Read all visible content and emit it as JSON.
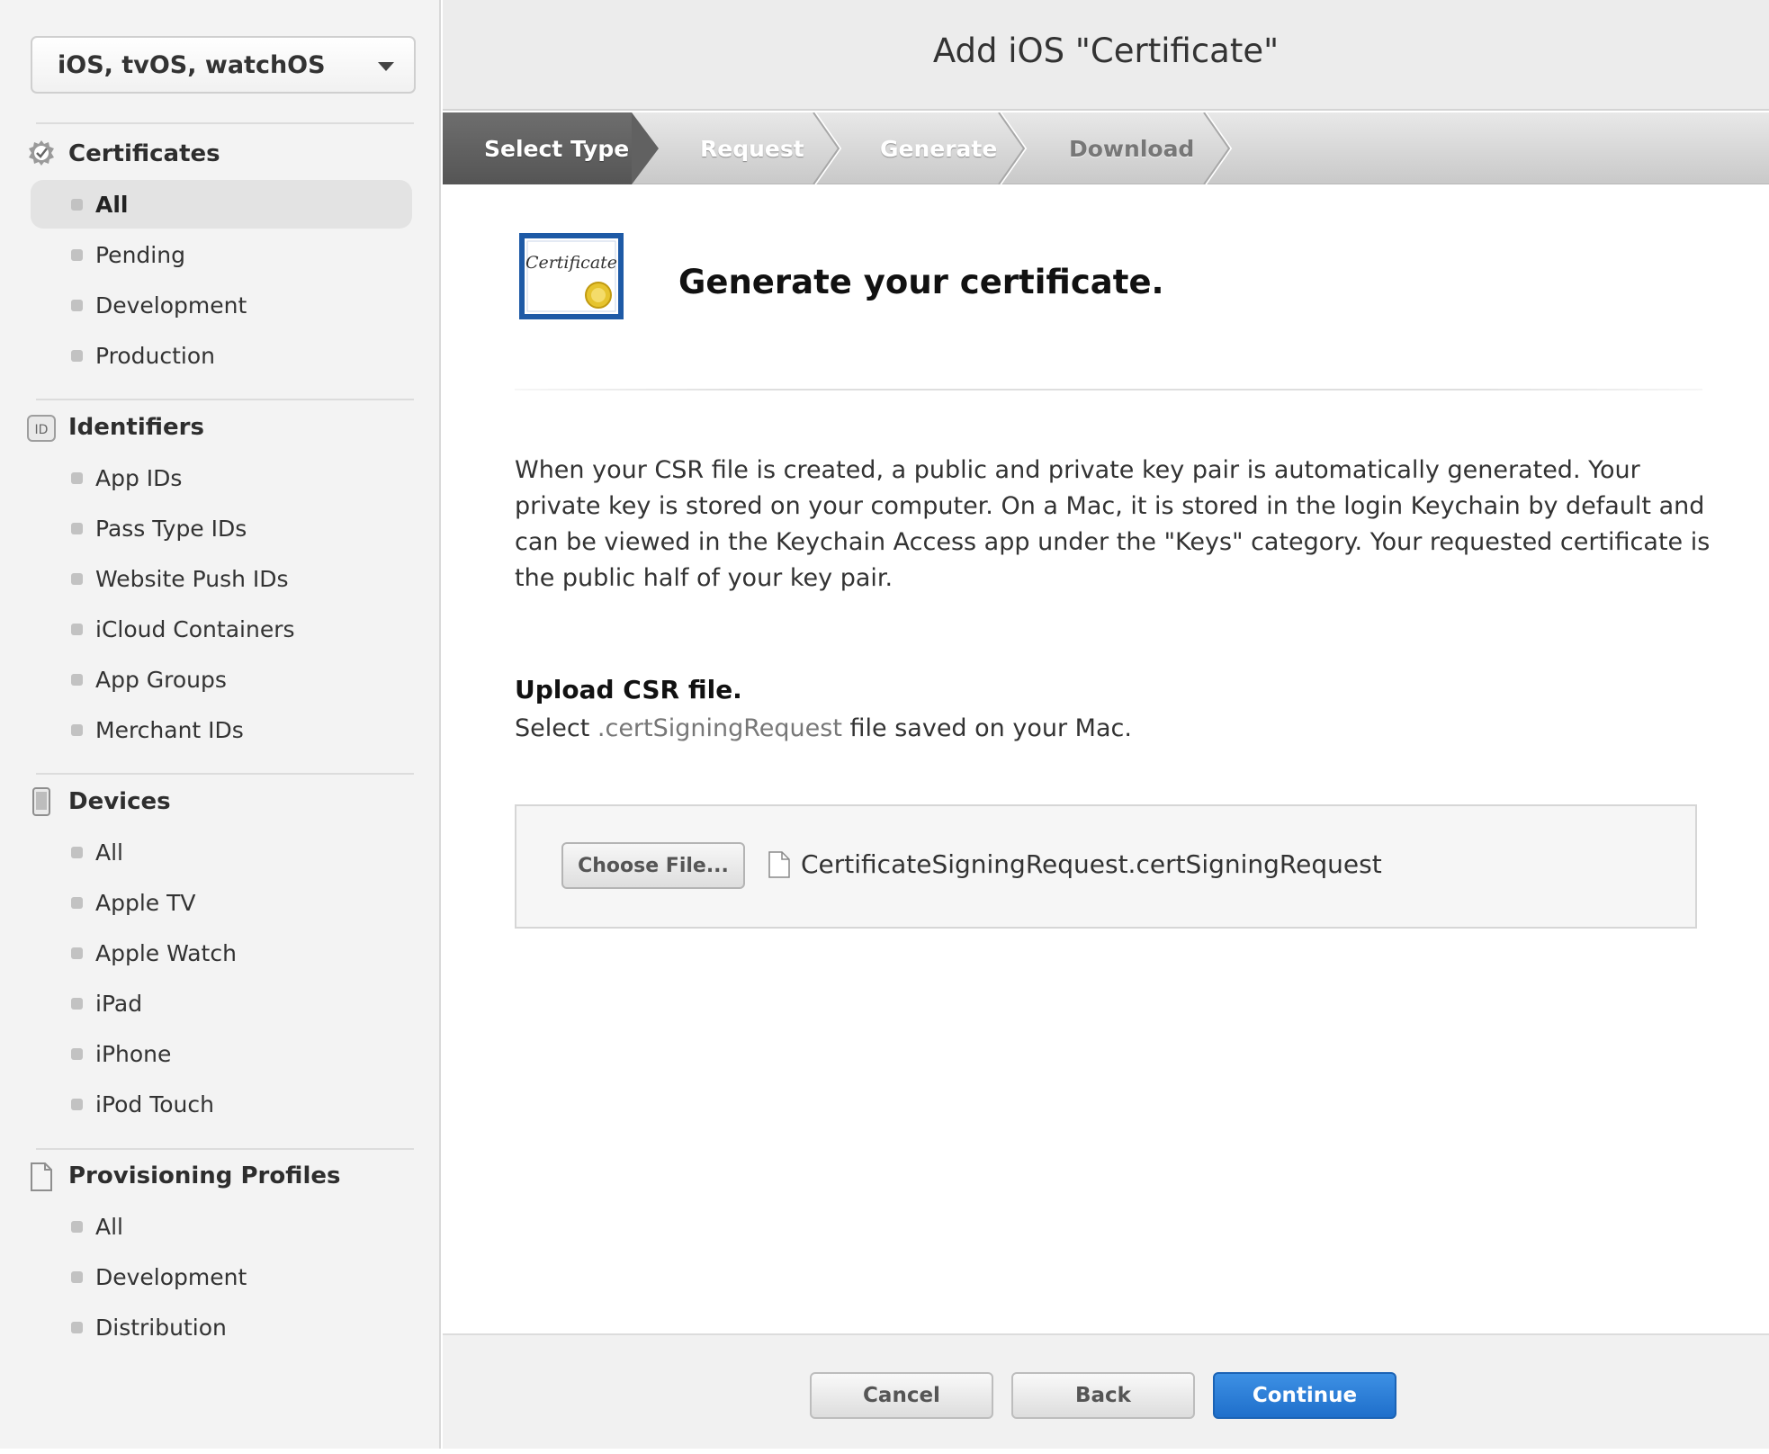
{
  "sidebar": {
    "platform_select": {
      "value": "iOS, tvOS, watchOS"
    },
    "sections": [
      {
        "title": "Certificates",
        "icon": "certificate-badge-icon",
        "items": [
          {
            "label": "All",
            "active": true
          },
          {
            "label": "Pending"
          },
          {
            "label": "Development"
          },
          {
            "label": "Production"
          }
        ]
      },
      {
        "title": "Identifiers",
        "icon": "id-badge-icon",
        "icon_text": "ID",
        "items": [
          {
            "label": "App IDs"
          },
          {
            "label": "Pass Type IDs"
          },
          {
            "label": "Website Push IDs"
          },
          {
            "label": "iCloud Containers"
          },
          {
            "label": "App Groups"
          },
          {
            "label": "Merchant IDs"
          }
        ]
      },
      {
        "title": "Devices",
        "icon": "device-icon",
        "items": [
          {
            "label": "All"
          },
          {
            "label": "Apple TV"
          },
          {
            "label": "Apple Watch"
          },
          {
            "label": "iPad"
          },
          {
            "label": "iPhone"
          },
          {
            "label": "iPod Touch"
          }
        ]
      },
      {
        "title": "Provisioning Profiles",
        "icon": "document-icon",
        "items": [
          {
            "label": "All"
          },
          {
            "label": "Development"
          },
          {
            "label": "Distribution"
          }
        ]
      }
    ]
  },
  "header": {
    "title": "Add iOS \"Certificate\""
  },
  "steps": [
    {
      "label": "Select Type",
      "active": true
    },
    {
      "label": "Request"
    },
    {
      "label": "Generate"
    },
    {
      "label": "Download"
    }
  ],
  "content": {
    "icon_text": "Certificate",
    "heading": "Generate your certificate.",
    "description": "When your CSR file is created, a public and private key pair is automatically generated. Your private key is stored on your computer. On a Mac, it is stored in the login Keychain by default and can be viewed in the Keychain Access app under the \"Keys\" category. Your requested certificate is the public half of your key pair.",
    "upload_heading": "Upload CSR file.",
    "upload_instructions": {
      "prefix": "Select ",
      "extension": ".certSigningRequest",
      "suffix": " file saved on your Mac."
    },
    "choose_file_label": "Choose File...",
    "file_name": "CertificateSigningRequest.certSigningRequest"
  },
  "footer": {
    "cancel_label": "Cancel",
    "back_label": "Back",
    "continue_label": "Continue"
  },
  "colors": {
    "primary_button": "#1f6fcb",
    "active_step": "#5c5c5c",
    "sidebar_bg": "#f3f3f3"
  }
}
